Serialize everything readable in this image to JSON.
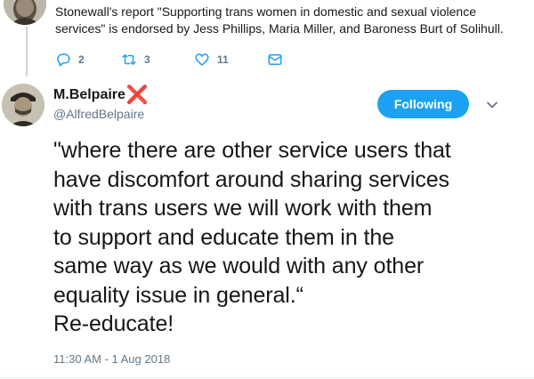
{
  "parent_tweet": {
    "text": "Stonewall's report \"Supporting trans women in domestic and sexual violence services\" is endorsed by Jess Phillips, Maria Miller, and Baroness Burt of Solihull.",
    "reply_count": "2",
    "retweet_count": "3",
    "like_count": "11"
  },
  "main_tweet": {
    "display_name": "M.Belpaire",
    "name_suffix": "❌",
    "handle": "@AlfredBelpaire",
    "follow_label": "Following",
    "body_lines": [
      "\"where there are other service users that",
      "have discomfort around sharing services",
      "with trans users we will work with them",
      "to support and educate them in the",
      "same way as we would with any other",
      "equality issue in general.“",
      "Re-educate!"
    ],
    "timestamp": "11:30 AM - 1 Aug 2018"
  },
  "icons": [
    "reply-icon",
    "retweet-icon",
    "like-icon",
    "direct-message-icon",
    "chevron-down-icon"
  ],
  "colors": {
    "accent": "#1da1f2",
    "secondary_text": "#657786",
    "name_mark": "#e0245e"
  }
}
